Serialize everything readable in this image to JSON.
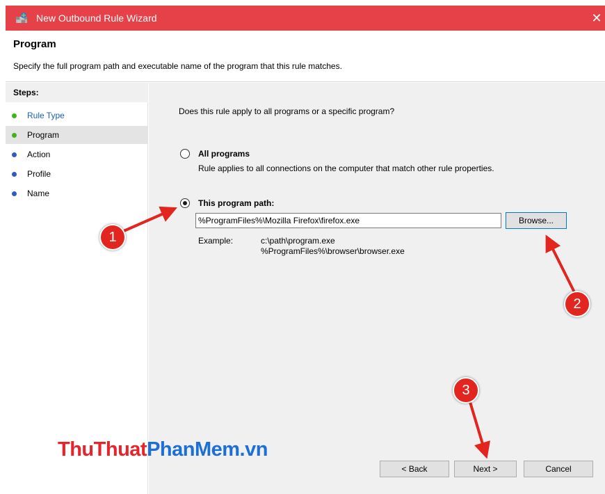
{
  "window": {
    "title": "New Outbound Rule Wizard",
    "close_glyph": "✕",
    "accent": "#e64049"
  },
  "header": {
    "heading": "Program",
    "description": "Specify the full program path and executable name of the program that this rule matches."
  },
  "sidebar": {
    "steps_label": "Steps:",
    "items": [
      {
        "label": "Rule Type",
        "status": "done"
      },
      {
        "label": "Program",
        "status": "done",
        "active": true
      },
      {
        "label": "Action",
        "status": "pending"
      },
      {
        "label": "Profile",
        "status": "pending"
      },
      {
        "label": "Name",
        "status": "pending"
      }
    ]
  },
  "main": {
    "question": "Does this rule apply to all programs or a specific program?",
    "options": [
      {
        "label": "All programs",
        "description": "Rule applies to all connections on the computer that match other rule properties.",
        "checked": false
      },
      {
        "label": "This program path:",
        "checked": true
      }
    ],
    "path_value": "%ProgramFiles%\\Mozilla Firefox\\firefox.exe",
    "browse_label": "Browse...",
    "example_label": "Example:",
    "example_lines": [
      "c:\\path\\program.exe",
      "%ProgramFiles%\\browser\\browser.exe"
    ]
  },
  "footer": {
    "back_label": "< Back",
    "next_label": "Next >",
    "cancel_label": "Cancel"
  },
  "watermark": {
    "part1": "ThuThuat",
    "part2": "PhanMem.vn"
  },
  "annotations": {
    "badges": [
      "1",
      "2",
      "3"
    ],
    "color": "#e2251f"
  }
}
